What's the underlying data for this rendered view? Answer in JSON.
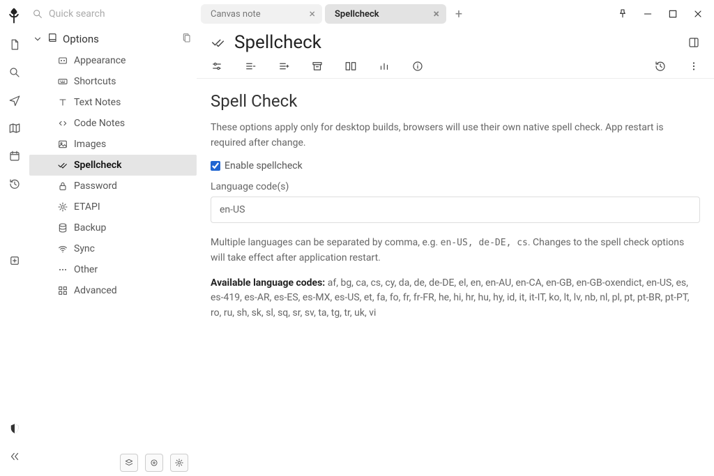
{
  "search": {
    "placeholder": "Quick search"
  },
  "tree": {
    "parent_label": "Options",
    "items": [
      {
        "label": "Appearance"
      },
      {
        "label": "Shortcuts"
      },
      {
        "label": "Text Notes"
      },
      {
        "label": "Code Notes"
      },
      {
        "label": "Images"
      },
      {
        "label": "Spellcheck"
      },
      {
        "label": "Password"
      },
      {
        "label": "ETAPI"
      },
      {
        "label": "Backup"
      },
      {
        "label": "Sync"
      },
      {
        "label": "Other"
      },
      {
        "label": "Advanced"
      }
    ]
  },
  "tabs": [
    {
      "title": "Canvas note"
    },
    {
      "title": "Spellcheck"
    }
  ],
  "page": {
    "title": "Spellcheck",
    "section_heading": "Spell Check",
    "intro": "These options apply only for desktop builds, browsers will use their own native spell check. App restart is required after change.",
    "enable_label": "Enable spellcheck",
    "enable_checked": true,
    "lang_label": "Language code(s)",
    "lang_value": "en-US",
    "help_prefix": "Multiple languages can be separated by comma, e.g. ",
    "help_code": "en-US, de-DE, cs",
    "help_suffix": ". Changes to the spell check options will take effect after application restart.",
    "codes_label": "Available language codes:",
    "codes_list": "af, bg, ca, cs, cy, da, de, de-DE, el, en, en-AU, en-CA, en-GB, en-GB-oxendict, en-US, es, es-419, es-AR, es-ES, es-MX, es-US, et, fa, fo, fr, fr-FR, he, hi, hr, hu, hy, id, it, it-IT, ko, lt, lv, nb, nl, pl, pt, pt-BR, pt-PT, ro, ru, sh, sk, sl, sq, sr, sv, ta, tg, tr, uk, vi"
  }
}
